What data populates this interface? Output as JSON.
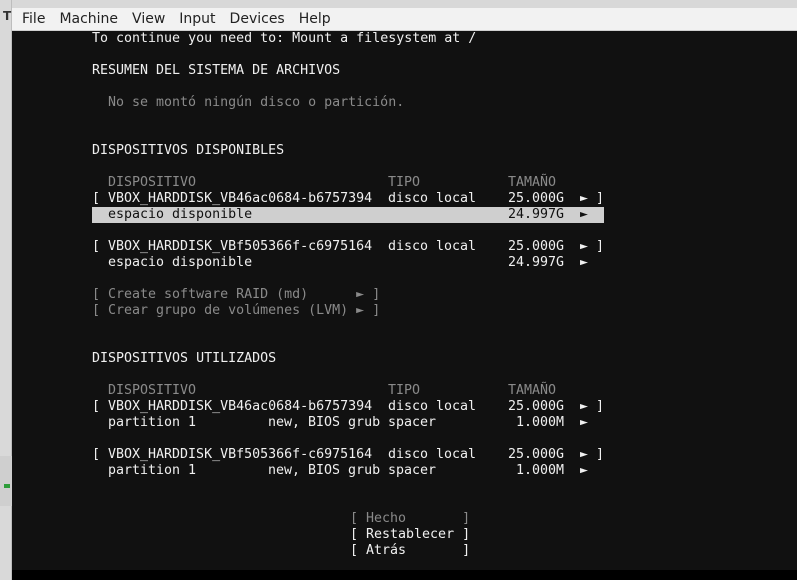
{
  "left_strip": {
    "top_fragment": "T"
  },
  "menubar": {
    "items": [
      "File",
      "Machine",
      "View",
      "Input",
      "Devices",
      "Help"
    ]
  },
  "terminal": {
    "header_text": "To continue you need to: Mount a filesystem at /",
    "summary_title": "RESUMEN DEL SISTEMA DE ARCHIVOS",
    "summary_empty": "No se montó ningún disco o partición.",
    "available_title": "DISPOSITIVOS DISPONIBLES",
    "available_header": {
      "dispositivo": "DISPOSITIVO",
      "tipo": "TIPO",
      "tamano": "TAMAÑO"
    },
    "available_disk1": {
      "bracket_open": "[",
      "name": "VBOX_HARDDISK_VB46ac0684-b6757394",
      "type": "disco local",
      "size": "25.000G",
      "arrow": "►",
      "bracket_close": "]"
    },
    "available_disk1_free": {
      "label": "espacio disponible",
      "size": "24.997G",
      "arrow": "►"
    },
    "available_disk2": {
      "bracket_open": "[",
      "name": "VBOX_HARDDISK_VBf505366f-c6975164",
      "type": "disco local",
      "size": "25.000G",
      "arrow": "►",
      "bracket_close": "]"
    },
    "available_disk2_free": {
      "label": "espacio disponible",
      "size": "24.997G",
      "arrow": "►"
    },
    "raid_option": "[ Create software RAID (md)      ► ]",
    "lvm_option": "[ Crear grupo de volúmenes (LVM) ► ]",
    "used_title": "DISPOSITIVOS UTILIZADOS",
    "used_header": {
      "dispositivo": "DISPOSITIVO",
      "tipo": "TIPO",
      "tamano": "TAMAÑO"
    },
    "used_disk1": {
      "bracket_open": "[",
      "name": "VBOX_HARDDISK_VB46ac0684-b6757394",
      "type": "disco local",
      "size": "25.000G",
      "arrow": "►",
      "bracket_close": "]"
    },
    "used_disk1_part": {
      "label": "partition 1",
      "detail": "new, BIOS grub",
      "type": "spacer",
      "size": "1.000M",
      "arrow": "►"
    },
    "used_disk2": {
      "bracket_open": "[",
      "name": "VBOX_HARDDISK_VBf505366f-c6975164",
      "type": "disco local",
      "size": "25.000G",
      "arrow": "►",
      "bracket_close": "]"
    },
    "used_disk2_part": {
      "label": "partition 1",
      "detail": "new, BIOS grub",
      "type": "spacer",
      "size": "1.000M",
      "arrow": "►"
    },
    "buttons": {
      "done": "[ Hecho       ]",
      "reset": "[ Restablecer ]",
      "back": "[ Atrás       ]"
    }
  }
}
